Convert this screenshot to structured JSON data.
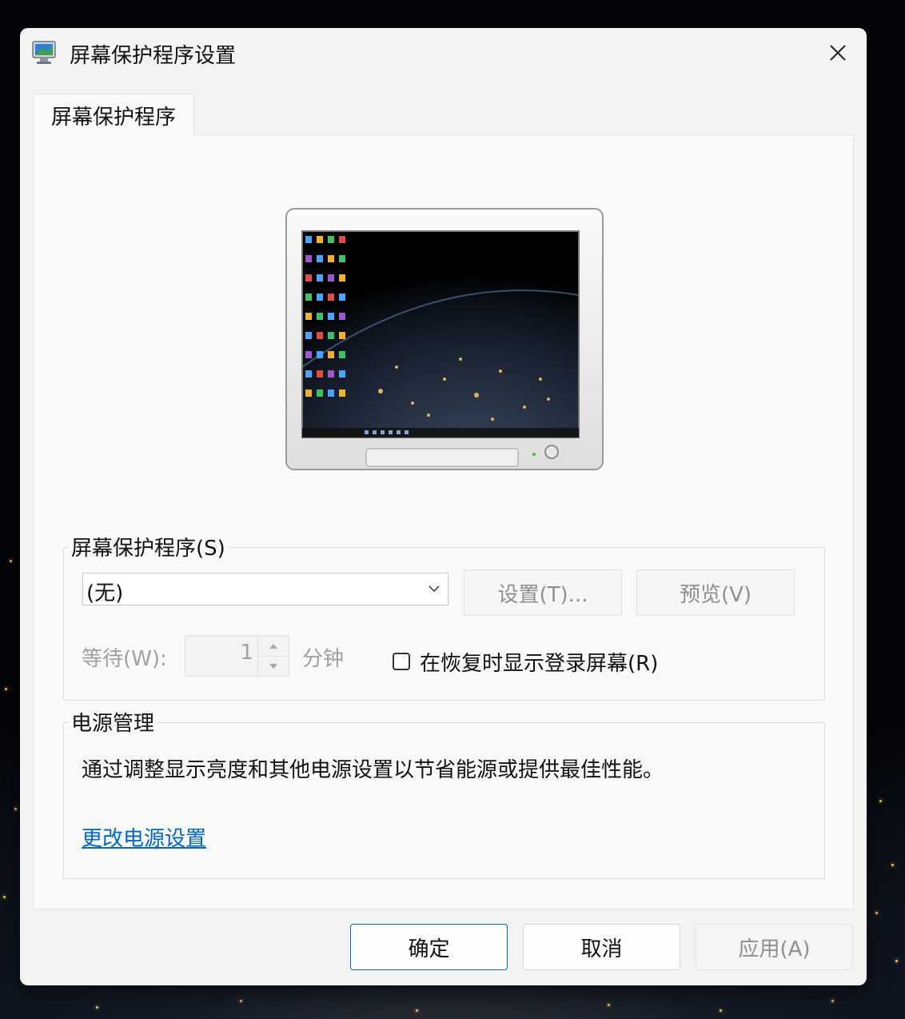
{
  "window": {
    "title": "屏幕保护程序设置"
  },
  "tab": {
    "label": "屏幕保护程序"
  },
  "screensaver": {
    "group_label": "屏幕保护程序(S)",
    "selected": "(无)",
    "settings_button": "设置(T)...",
    "preview_button": "预览(V)",
    "wait_label": "等待(W):",
    "wait_value": "1",
    "minutes_label": "分钟",
    "resume_label": "在恢复时显示登录屏幕(R)",
    "resume_checked": false
  },
  "power": {
    "group_label": "电源管理",
    "description": "通过调整显示亮度和其他电源设置以节省能源或提供最佳性能。",
    "link": "更改电源设置"
  },
  "footer": {
    "ok": "确定",
    "cancel": "取消",
    "apply": "应用(A)"
  },
  "colors": {
    "link": "#0067c0",
    "ok_border": "#0067c0",
    "disabled_text": "#8f8f8f"
  }
}
